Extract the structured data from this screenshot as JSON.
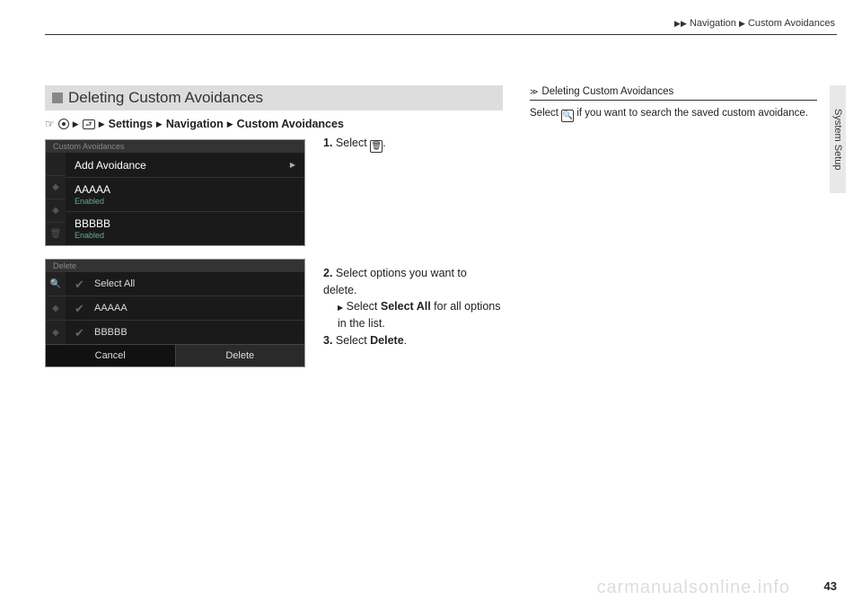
{
  "header": {
    "crumb1": "Navigation",
    "crumb2": "Custom Avoidances"
  },
  "side_tab": "System Setup",
  "section_title": "Deleting Custom Avoidances",
  "nav_path": {
    "settings": "Settings",
    "navigation": "Navigation",
    "custom": "Custom Avoidances"
  },
  "screenshot1": {
    "title": "Custom Avoidances",
    "row1": "Add Avoidance",
    "row2": "AAAAA",
    "row2_sub": "Enabled",
    "row3": "BBBBB",
    "row3_sub": "Enabled"
  },
  "screenshot2": {
    "title": "Delete",
    "row1": "Select All",
    "row2": "AAAAA",
    "row3": "BBBBB",
    "btn_cancel": "Cancel",
    "btn_delete": "Delete"
  },
  "steps": {
    "s1_num": "1.",
    "s1_text": "Select ",
    "s1_after": ".",
    "s2_num": "2.",
    "s2_text": "Select options you want to delete.",
    "s2_sub_pre": "Select ",
    "s2_sub_bold": "Select All",
    "s2_sub_post": " for all options in the list.",
    "s3_num": "3.",
    "s3_pre": "Select ",
    "s3_bold": "Delete",
    "s3_post": "."
  },
  "sidebar": {
    "title": "Deleting Custom Avoidances",
    "body_pre": "Select ",
    "body_post": " if you want to search the saved custom avoidance."
  },
  "page_num": "43",
  "watermark": "carmanualsonline.info"
}
